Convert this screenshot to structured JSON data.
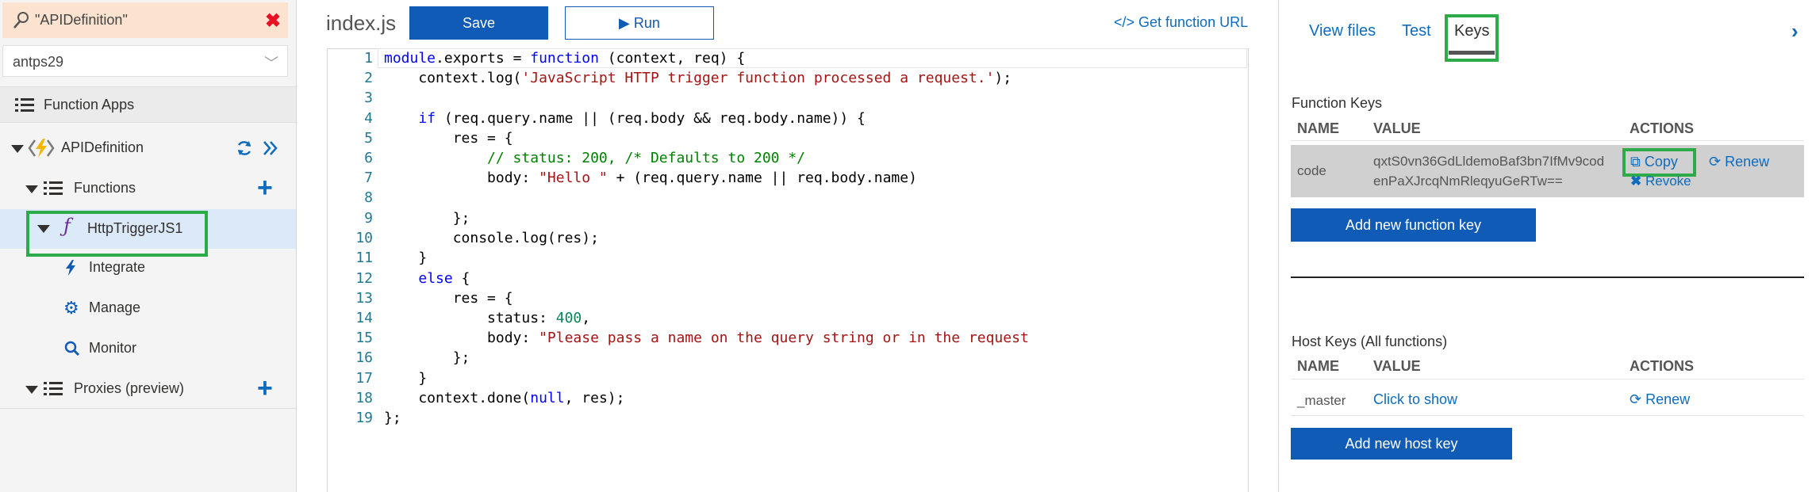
{
  "sidebar": {
    "search_value": "\"APIDefinition\"",
    "subscription_value": "antps29",
    "function_apps_label": "Function Apps",
    "app_name": "APIDefinition",
    "functions_label": "Functions",
    "selected_function": "HttpTriggerJS1",
    "sub_items": [
      "Integrate",
      "Manage",
      "Monitor"
    ],
    "proxies_label": "Proxies (preview)"
  },
  "editor": {
    "file_name": "index.js",
    "save_label": "Save",
    "run_label": "Run",
    "get_url_label": "</> Get function URL",
    "line_numbers": [
      "1",
      "2",
      "3",
      "4",
      "5",
      "6",
      "7",
      "8",
      "9",
      "10",
      "11",
      "12",
      "13",
      "14",
      "15",
      "16",
      "17",
      "18",
      "19"
    ],
    "code": {
      "l1a": "module",
      "l1b": ".exports = ",
      "l1c": "function",
      "l1d": " (context, req) {",
      "l2a": "    context.log(",
      "l2b": "'JavaScript HTTP trigger function processed a request.'",
      "l2c": ");",
      "l4a": "    ",
      "l4b": "if",
      "l4c": " (req.query.name || (req.body && req.body.name)) {",
      "l5": "        res = {",
      "l6a": "            ",
      "l6b": "// status: 200, /* Defaults to 200 */",
      "l7a": "            body: ",
      "l7b": "\"Hello \"",
      "l7c": " + (req.query.name || req.body.name)",
      "l9": "        };",
      "l10": "        console.log(res);",
      "l11": "    }",
      "l12a": "    ",
      "l12b": "else",
      "l12c": " {",
      "l13": "        res = {",
      "l14a": "            status: ",
      "l14b": "400",
      "l14c": ",",
      "l15a": "            body: ",
      "l15b": "\"Please pass a name on the query string or in the request",
      "l16": "        };",
      "l17": "    }",
      "l18a": "    context.done(",
      "l18b": "null",
      "l18c": ", res);",
      "l19": "};"
    }
  },
  "right_panel": {
    "tabs": [
      "View files",
      "Test",
      "Keys"
    ],
    "function_keys": {
      "title": "Function Keys",
      "headers": [
        "NAME",
        "VALUE",
        "ACTIONS"
      ],
      "row": {
        "name": "code",
        "value_line1": "qxtS0vn36GdLldemoBaf3bn7IfMv9cod",
        "value_line2": "enPaXJrcqNmRleqyuGeRTw==",
        "copy": "Copy",
        "renew": "Renew",
        "revoke": "Revoke"
      },
      "add_button": "Add new function key"
    },
    "host_keys": {
      "title": "Host Keys (All functions)",
      "headers": [
        "NAME",
        "VALUE",
        "ACTIONS"
      ],
      "row": {
        "name": "_master",
        "value": "Click to show",
        "renew": "Renew"
      },
      "add_button": "Add new host key"
    }
  },
  "colors": {
    "accent": "#0f5bb5",
    "highlight": "#2dab48",
    "search_bg": "#fbe3cf"
  }
}
